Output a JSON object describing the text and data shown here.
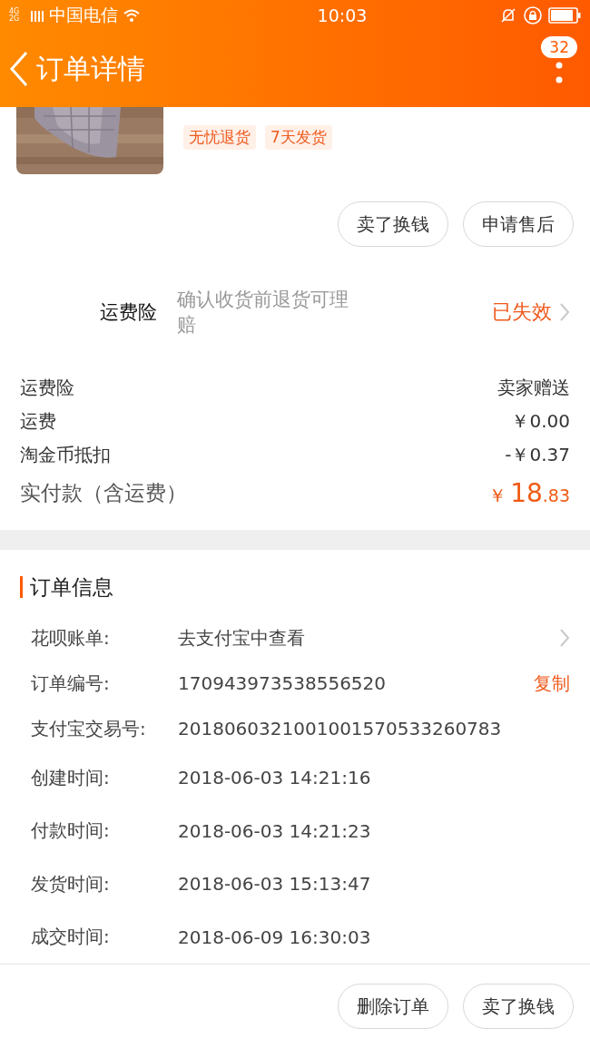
{
  "status_bar": {
    "network": "4G 2G",
    "carrier": "中国电信",
    "time": "10:03"
  },
  "header": {
    "title": "订单详情",
    "badge": "32"
  },
  "product": {
    "tags": [
      "无忧退货",
      "7天发货"
    ]
  },
  "product_actions": [
    "卖了换钱",
    "申请售后"
  ],
  "insurance": {
    "label": "运费险",
    "description": "确认收货前退货可理赔",
    "status": "已失效"
  },
  "fees": [
    {
      "label": "运费险",
      "value": "卖家赠送"
    },
    {
      "label": "运费",
      "value": "￥0.00"
    },
    {
      "label": "淘金币抵扣",
      "value": "-￥0.37"
    }
  ],
  "total": {
    "label": "实付款（含运费）",
    "currency": "￥",
    "integer": "18",
    "decimal": ".83"
  },
  "order_info": {
    "title": "订单信息",
    "rows": [
      {
        "kind": "link",
        "label": "花呗账单:",
        "value": "去支付宝中查看"
      },
      {
        "kind": "copy",
        "label": "订单编号:",
        "value": "170943973538556520",
        "action": "复制"
      },
      {
        "kind": "plain",
        "label": "支付宝交易号:",
        "value": "2018060321001001570533260783"
      },
      {
        "kind": "plain",
        "label": "创建时间:",
        "value": "2018-06-03 14:21:16"
      },
      {
        "kind": "plain",
        "label": "付款时间:",
        "value": "2018-06-03 14:21:23"
      },
      {
        "kind": "plain",
        "label": "发货时间:",
        "value": "2018-06-03 15:13:47"
      },
      {
        "kind": "plain",
        "label": "成交时间:",
        "value": "2018-06-09 16:30:03"
      }
    ]
  },
  "bottom_actions": [
    "删除订单",
    "卖了换钱"
  ]
}
